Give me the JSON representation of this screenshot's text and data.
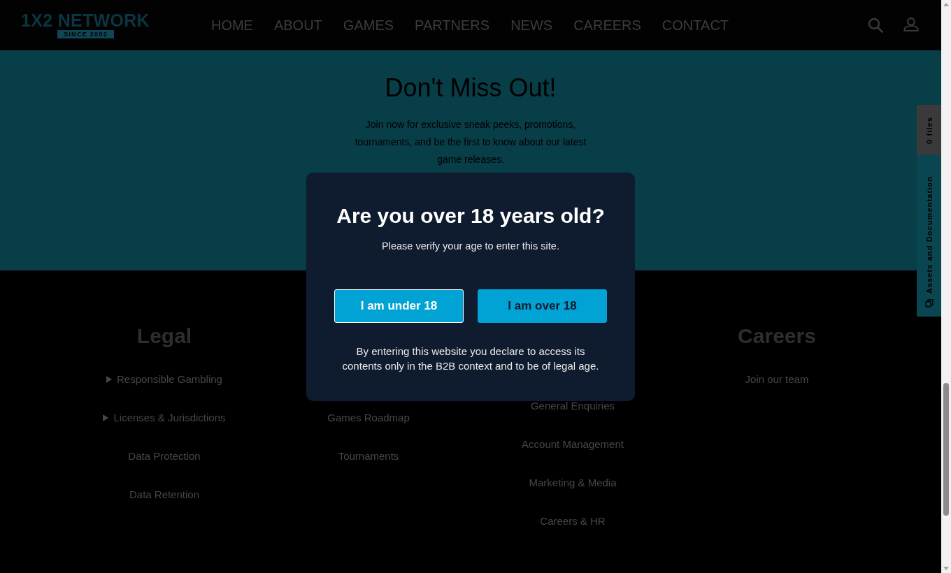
{
  "header": {
    "logo": {
      "name": "1X2 NETWORK",
      "tagline": "SINCE 2002"
    },
    "nav": [
      {
        "label": "HOME"
      },
      {
        "label": "ABOUT"
      },
      {
        "label": "GAMES"
      },
      {
        "label": "PARTNERS"
      },
      {
        "label": "NEWS"
      },
      {
        "label": "CAREERS"
      },
      {
        "label": "CONTACT"
      }
    ]
  },
  "banner": {
    "title": "Don't Miss Out!",
    "text": "Join now for exclusive sneak peeks, promotions, tournaments, and be the first to know about our latest game releases."
  },
  "footer": {
    "columns": [
      {
        "heading": "Legal",
        "links": [
          {
            "label": "Responsible Gambling",
            "kind": "expandable"
          },
          {
            "label": "Licenses & Jurisdictions",
            "kind": "expandable"
          },
          {
            "label": "Data Protection",
            "kind": "link"
          },
          {
            "label": "Data Retention",
            "kind": "link"
          }
        ]
      },
      {
        "links": [
          {
            "label": "Games Roadmap",
            "kind": "link"
          },
          {
            "label": "Tournaments",
            "kind": "link"
          }
        ]
      },
      {
        "links": [
          {
            "label": "General Enquiries",
            "kind": "link"
          },
          {
            "label": "Account Management",
            "kind": "link"
          },
          {
            "label": "Marketing & Media",
            "kind": "link"
          },
          {
            "label": "Careers & HR",
            "kind": "link"
          }
        ]
      },
      {
        "heading": "Careers",
        "links": [
          {
            "label": "Join our team",
            "kind": "link"
          }
        ]
      }
    ]
  },
  "side_tabs": [
    {
      "label": "0 files",
      "kind": "counter"
    },
    {
      "label": "Assets and Documentation",
      "kind": "panel"
    }
  ],
  "dialog": {
    "title": "Are you over 18 years old?",
    "subtitle": "Please verify your age to enter this site.",
    "buttons": [
      {
        "label": "I am under 18",
        "kind": "outlined"
      },
      {
        "label": "I am over 18",
        "kind": "filled"
      }
    ],
    "note": "By entering this website you declare to access its contents only in the B2B context and to be of legal age."
  }
}
